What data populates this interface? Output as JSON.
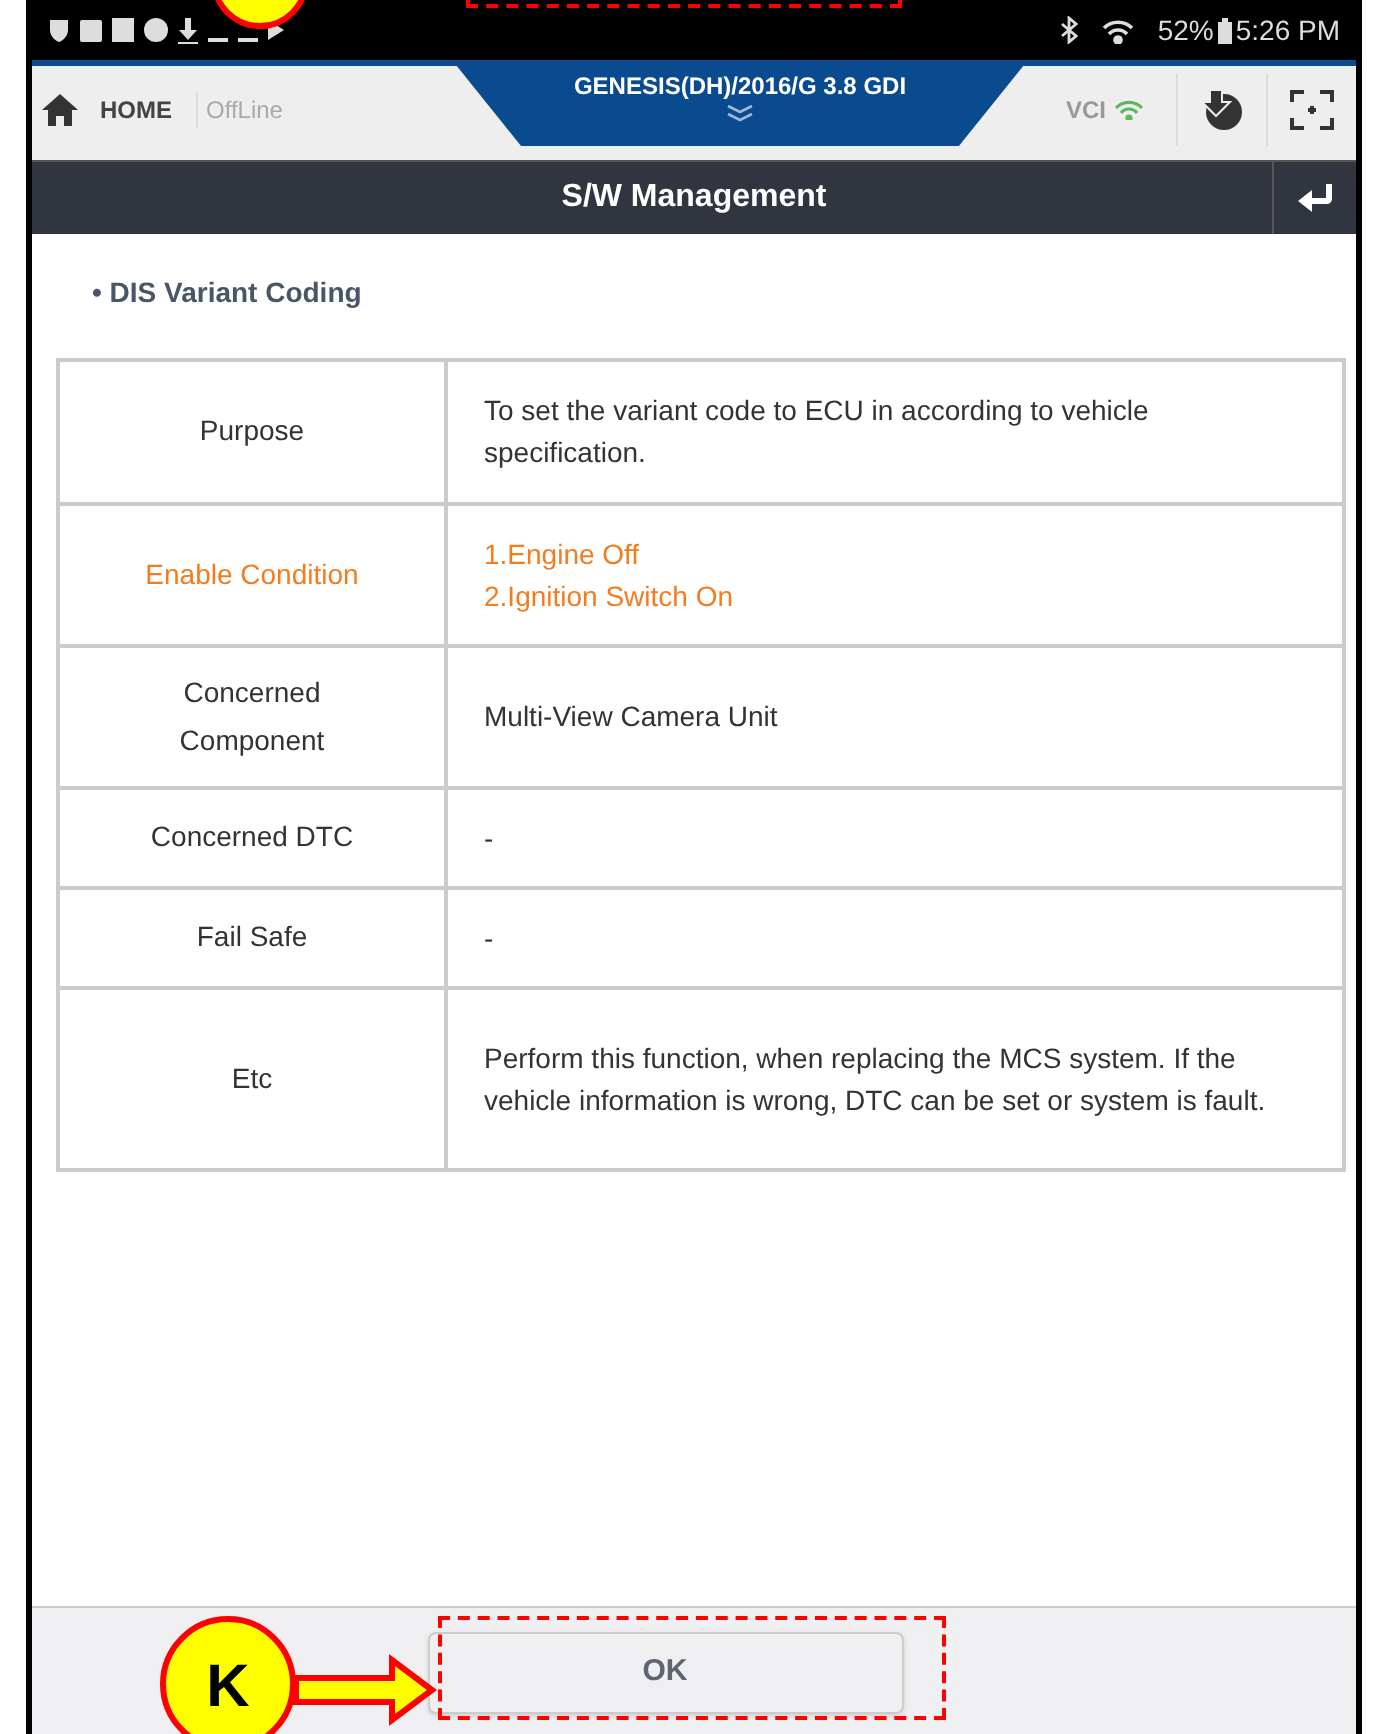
{
  "status_bar": {
    "battery": "52%",
    "time": "5:26 PM"
  },
  "header": {
    "home": "HOME",
    "mode": "OffLine",
    "vehicle": "GENESIS(DH)/2016/G 3.8 GDI",
    "vci": "VCI"
  },
  "title_bar": {
    "title": "S/W Management"
  },
  "section": {
    "title": "• DIS Variant Coding"
  },
  "table": {
    "rows": [
      {
        "label": "Purpose",
        "value": "To set the variant code to ECU in according to vehicle specification.",
        "highlighted": false
      },
      {
        "label": "Enable Condition",
        "value": "1.Engine Off\n2.Ignition Switch On",
        "highlighted": true
      },
      {
        "label": "Concerned\nComponent",
        "value": "Multi-View Camera Unit",
        "highlighted": false
      },
      {
        "label": "Concerned DTC",
        "value": "-",
        "highlighted": false
      },
      {
        "label": "Fail Safe",
        "value": "-",
        "highlighted": false
      },
      {
        "label": "Etc",
        "value": "Perform this function, when replacing the MCS system. If the vehicle information is wrong, DTC can be set or system is fault.",
        "highlighted": false
      }
    ]
  },
  "buttons": [
    "OK"
  ],
  "annotation": {
    "callout": "K"
  }
}
